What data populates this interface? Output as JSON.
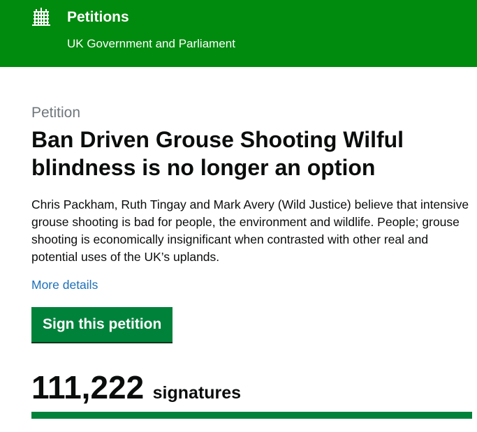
{
  "header": {
    "logo_icon": "portcullis-icon",
    "title": "Petitions",
    "subtitle": "UK Government and Parliament",
    "background_color": "#008a0e"
  },
  "petition": {
    "eyebrow": "Petition",
    "title": "Ban Driven Grouse Shooting Wilful blindness is no longer an option",
    "summary": "Chris Packham, Ruth Tingay and Mark Avery (Wild Justice) believe that intensive grouse shooting is bad for people, the environment and wildlife. People; grouse shooting is economically insignificant when contrasted with other real and potential uses of the UK’s uplands.",
    "more_details_label": "More details",
    "sign_button_label": "Sign this petition",
    "signature_count": "111,222",
    "signature_label": "signatures",
    "progress_fraction": 1.0,
    "accent_color": "#00823b",
    "link_color": "#1d70b8"
  }
}
